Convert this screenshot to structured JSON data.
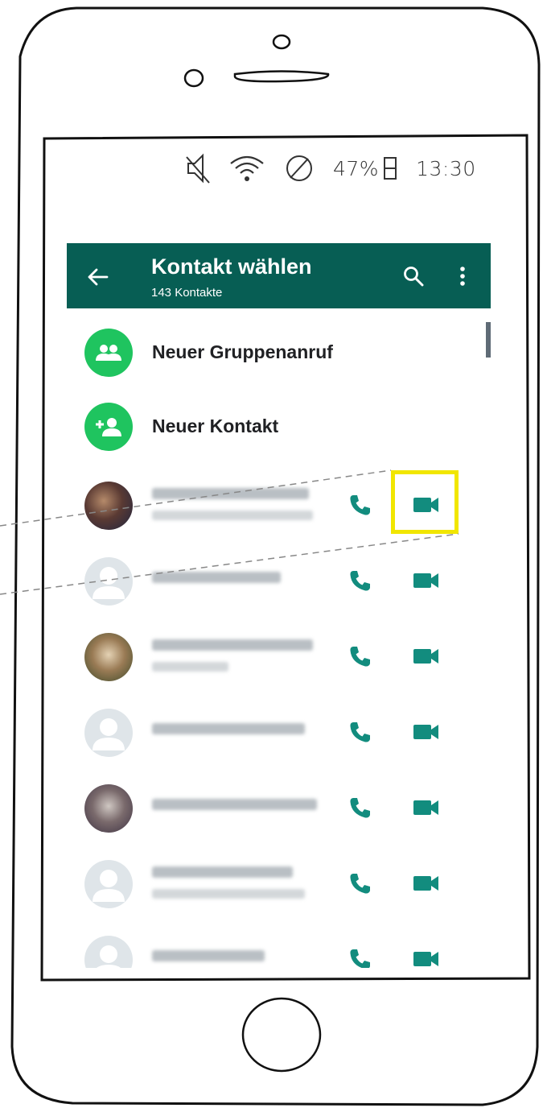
{
  "status_bar": {
    "battery_text": "47%",
    "time": "13:30",
    "icons": [
      "mute-icon",
      "wifi-icon",
      "no-disturb-icon",
      "battery-icon"
    ]
  },
  "app_bar": {
    "title": "Kontakt wählen",
    "subtitle": "143 Kontakte",
    "icons": [
      "back-arrow-icon",
      "search-icon",
      "more-vert-icon"
    ]
  },
  "actions": [
    {
      "label": "Neuer Gruppenanruf",
      "icon": "group-icon"
    },
    {
      "label": "Neuer Kontakt",
      "icon": "add-person-icon"
    }
  ],
  "colors": {
    "app_bar": "#075e54",
    "accent_green": "#1fc45f",
    "call_icon": "#128c7e",
    "highlight": "#f1e600"
  }
}
